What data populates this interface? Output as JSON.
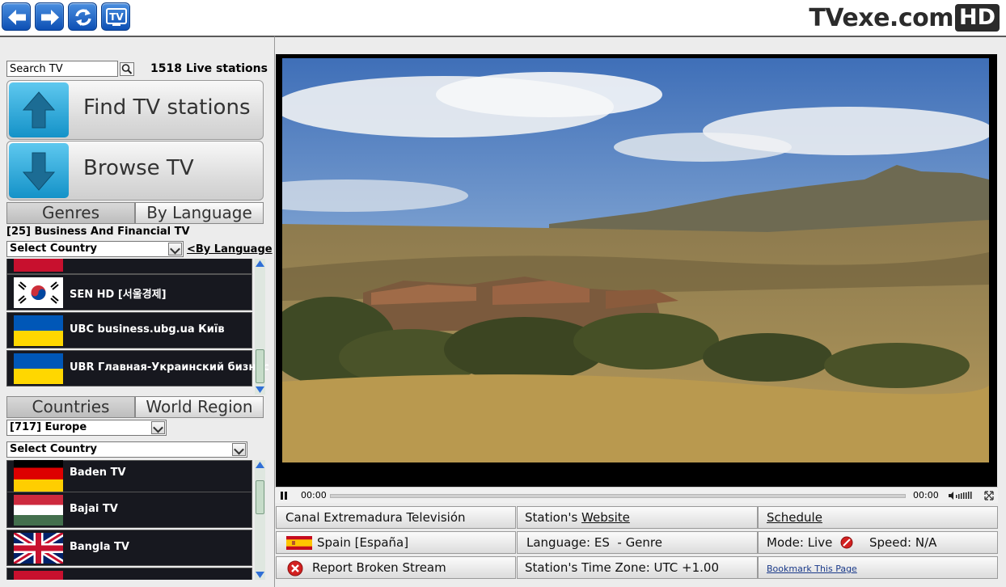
{
  "topbar": {
    "logo_text": "TVexe.com",
    "logo_badge": "HD",
    "nav_icons": [
      "back-arrow-icon",
      "forward-arrow-icon",
      "refresh-icon",
      "tv-icon"
    ],
    "tv_icon_text": "TV"
  },
  "search": {
    "value": "Search TV",
    "live_count": "1518 Live stations"
  },
  "buttons": {
    "find": "Find TV stations",
    "browse": "Browse TV"
  },
  "genre_tabs": {
    "genres": "Genres",
    "by_language": "By Language"
  },
  "genre_label": "[25] Business And Financial TV",
  "genre_select": "Select Country",
  "by_language_link": "<By Language",
  "genre_stations": [
    {
      "name": "SEN HD [서울경제]",
      "flag": "kr"
    },
    {
      "name": "UBC business.ubg.ua Київ",
      "flag": "ua"
    },
    {
      "name": "UBR Главная-Украинский бизнес",
      "flag": "ua"
    }
  ],
  "region_tabs": {
    "countries": "Countries",
    "world_region": "World Region"
  },
  "region_select": "[717] Europe",
  "region_country_select": "Select Country",
  "region_stations": [
    {
      "name": "Baden TV",
      "flag": "de"
    },
    {
      "name": "Bajai TV",
      "flag": "hu"
    },
    {
      "name": "Bangla TV",
      "flag": "gb"
    }
  ],
  "player": {
    "time_current": "00:00",
    "time_total": "00:00"
  },
  "info": {
    "station_name": "Canal Extremadura Televisión",
    "website_prefix": "Station's ",
    "website_link": "Website",
    "schedule": "Schedule",
    "country": "Spain [España]",
    "language": "Language: ES  - Genre",
    "mode_label": "Mode: Live",
    "speed": "Speed: N/A",
    "report": "Report Broken Stream",
    "timezone": "Station's Time Zone: UTC +1.00",
    "bookmark": "Bookmark This Page"
  },
  "colors": {
    "accent_blue": "#1492c8",
    "nav_blue": "#0d4fb4",
    "list_bg": "#17181f",
    "report_red": "#d32020"
  }
}
